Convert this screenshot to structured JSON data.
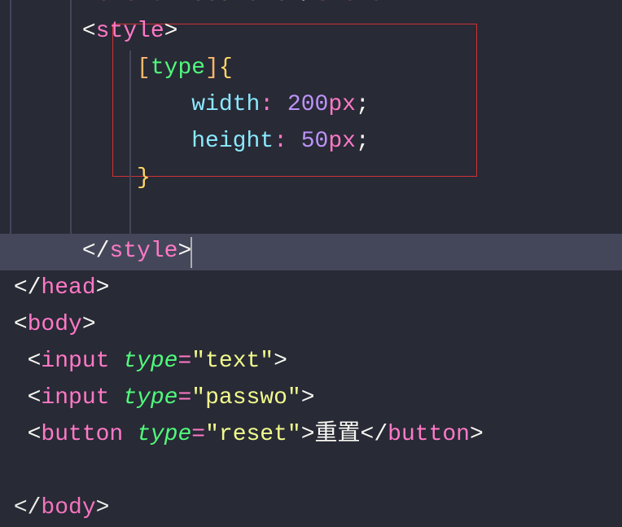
{
  "code": {
    "title_open": "title",
    "title_text": "Document",
    "title_close": "title",
    "style_open": "style",
    "selector_open": "[",
    "selector_name": "type",
    "selector_close": "]",
    "brace_open": "{",
    "prop1": "width",
    "colon": ":",
    "val1_num": "200",
    "val1_unit": "px",
    "semi": ";",
    "prop2": "height",
    "val2_num": "50",
    "val2_unit": "px",
    "brace_close": "}",
    "style_close": "style",
    "head_close": "head",
    "body_open": "body",
    "input_tag": "input",
    "type_attr": "type",
    "eq": "=",
    "val_text": "\"text\"",
    "val_passwo": "\"passwo\"",
    "button_tag": "button",
    "val_reset": "\"reset\"",
    "button_text": "重置",
    "button_close": "button",
    "body_close": "body",
    "lt": "<",
    "gt": ">",
    "lts": "</"
  }
}
